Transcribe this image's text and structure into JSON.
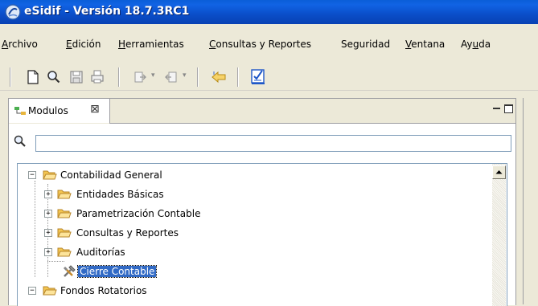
{
  "window": {
    "title": "eSidif - Versión 18.7.3RC1",
    "titlebar_color": "#0a5ed8",
    "logo_icon": "esidif-logo-icon"
  },
  "menubar": {
    "items": [
      {
        "label": "Archivo",
        "mnemonic": "A",
        "rest": "rchivo"
      },
      {
        "label": "Edición",
        "mnemonic": "E",
        "rest": "dición"
      },
      {
        "label": "Herramientas",
        "mnemonic": "H",
        "rest": "erramientas"
      },
      {
        "label": "Consultas y Reportes",
        "mnemonic": "C",
        "rest": "onsultas y Reportes"
      },
      {
        "label": "Seguridad",
        "mnemonic": "",
        "rest": "Seguridad"
      },
      {
        "label": "Ventana",
        "mnemonic": "V",
        "rest": "entana"
      },
      {
        "label": "Ayuda",
        "pre": "Ay",
        "mnemonic": "u",
        "rest": "da"
      }
    ]
  },
  "toolbar": {
    "icons": [
      "new-document-icon",
      "search-icon",
      "save-icon",
      "print-icon",
      "import-icon",
      "export-icon",
      "back-icon",
      "checklist-icon"
    ]
  },
  "view": {
    "tab_label": "Modulos",
    "tab_close": "⊠",
    "search_placeholder": "",
    "search_value": ""
  },
  "tree": {
    "selected_color": "#316ac5",
    "nodes": [
      {
        "label": "Contabilidad General",
        "expander": "−",
        "level": 0,
        "icon": "folder-open-icon"
      },
      {
        "label": "Entidades Básicas",
        "expander": "+",
        "level": 1,
        "icon": "folder-open-icon"
      },
      {
        "label": "Parametrización Contable",
        "expander": "+",
        "level": 1,
        "icon": "folder-open-icon"
      },
      {
        "label": "Consultas y Reportes",
        "expander": "+",
        "level": 1,
        "icon": "folder-open-icon"
      },
      {
        "label": "Auditorías",
        "expander": "+",
        "level": 1,
        "icon": "folder-open-icon"
      },
      {
        "label": "Cierre Contable",
        "expander": "",
        "level": 1,
        "icon": "tools-icon",
        "selected": true
      },
      {
        "label": "Fondos Rotatorios",
        "expander": "−",
        "level": 0,
        "icon": "folder-open-icon"
      }
    ]
  }
}
